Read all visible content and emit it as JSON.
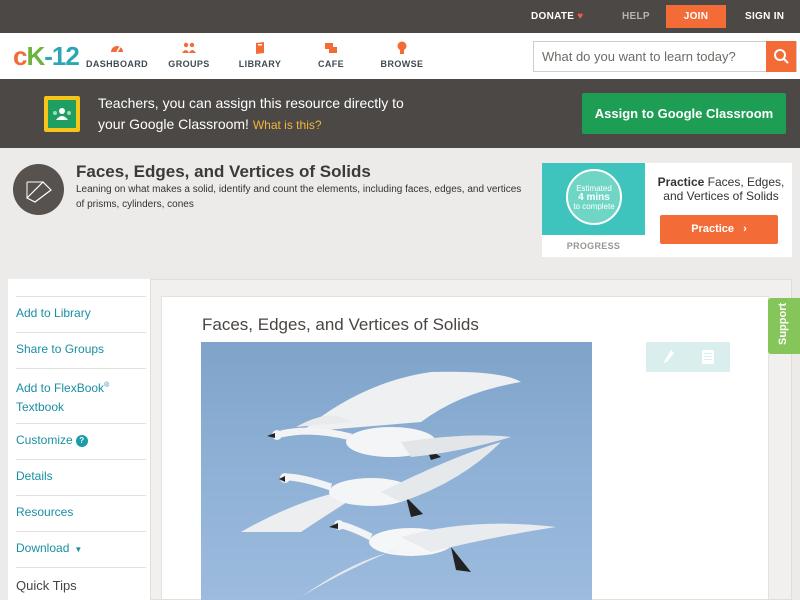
{
  "topbar": {
    "donate": "DONATE",
    "help": "HELP",
    "join": "JOIN",
    "signin": "SIGN IN"
  },
  "nav": {
    "logo": {
      "part1": "c",
      "part2": "K",
      "part3": "-12"
    },
    "items": [
      {
        "label": "DASHBOARD",
        "icon": "dashboard-icon"
      },
      {
        "label": "GROUPS",
        "icon": "groups-icon"
      },
      {
        "label": "LIBRARY",
        "icon": "library-icon"
      },
      {
        "label": "CAFE",
        "icon": "cafe-icon"
      },
      {
        "label": "BROWSE",
        "icon": "browse-icon"
      }
    ],
    "search_placeholder": "What do you want to learn today?"
  },
  "google_classroom": {
    "line1": "Teachers, you can assign this resource directly to",
    "line2": "your Google Classroom!",
    "what_link": "What is this?",
    "button": "Assign to Google Classroom"
  },
  "header": {
    "title": "Faces, Edges, and Vertices of Solids",
    "description": "Leaning on what makes a solid, identify and count the elements, including faces, edges, and vertices of prisms, cylinders, cones"
  },
  "practice": {
    "badge_top": "Estimated",
    "badge_mid": "4 mins",
    "badge_bottom": "to complete",
    "progress_label": "PROGRESS",
    "title_bold": "Practice",
    "title_rest": " Faces, Edges, and Vertices of Solids",
    "button": "Practice"
  },
  "sidebar": {
    "add_library": "Add to Library",
    "share_groups": "Share to Groups",
    "add_flexbook_1": "Add to FlexBook",
    "add_flexbook_sup": "®",
    "add_flexbook_2": "Textbook",
    "customize": "Customize",
    "details": "Details",
    "resources": "Resources",
    "download": "Download",
    "quick_tips": "Quick Tips"
  },
  "content": {
    "title": "Faces, Edges, and Vertices of Solids"
  },
  "support": "Support",
  "colors": {
    "brand_orange": "#f36c37",
    "dark_bar": "#4b4845",
    "google_green": "#1e9e55",
    "link_teal": "#1a8fa4",
    "support_green": "#86c55a"
  }
}
